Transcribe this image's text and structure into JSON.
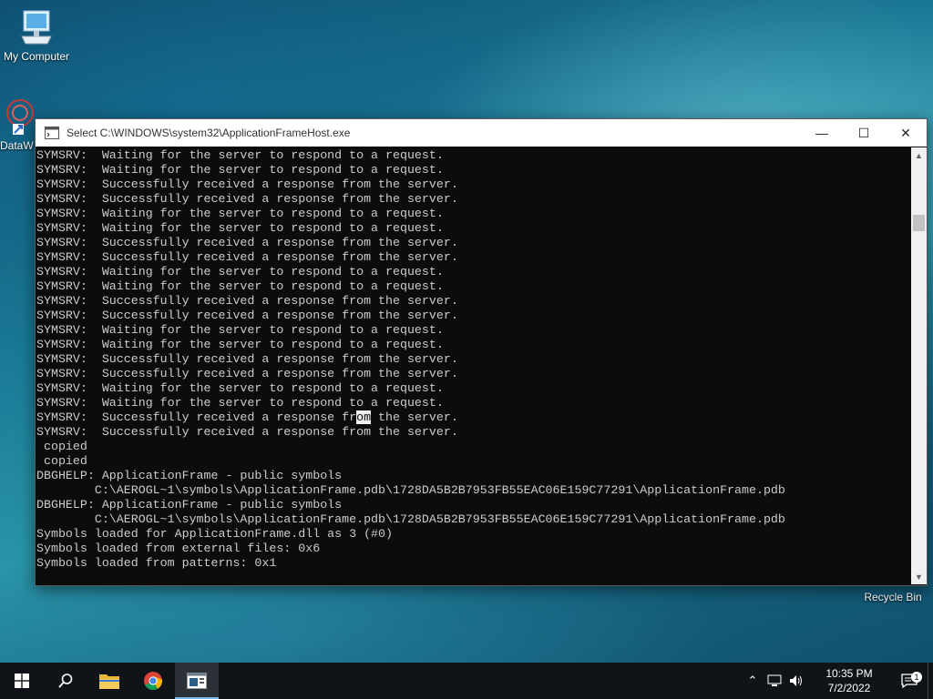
{
  "desktop": {
    "icons": [
      {
        "label": "My Computer",
        "icon": "computer-icon"
      },
      {
        "label": "DataW",
        "icon": "dataw-icon"
      },
      {
        "label": "Recycle Bin",
        "icon": "recycle-bin-icon"
      }
    ]
  },
  "window": {
    "title": "Select C:\\WINDOWS\\system32\\ApplicationFrameHost.exe",
    "controls": {
      "minimize": "—",
      "maximize": "☐",
      "close": "✕"
    }
  },
  "console": {
    "lines": [
      "SYMSRV:  Waiting for the server to respond to a request.",
      "SYMSRV:  Waiting for the server to respond to a request.",
      "SYMSRV:  Successfully received a response from the server.",
      "SYMSRV:  Successfully received a response from the server.",
      "SYMSRV:  Waiting for the server to respond to a request.",
      "SYMSRV:  Waiting for the server to respond to a request.",
      "SYMSRV:  Successfully received a response from the server.",
      "SYMSRV:  Successfully received a response from the server.",
      "SYMSRV:  Waiting for the server to respond to a request.",
      "SYMSRV:  Waiting for the server to respond to a request.",
      "SYMSRV:  Successfully received a response from the server.",
      "SYMSRV:  Successfully received a response from the server.",
      "SYMSRV:  Waiting for the server to respond to a request.",
      "SYMSRV:  Waiting for the server to respond to a request.",
      "SYMSRV:  Successfully received a response from the server.",
      "SYMSRV:  Successfully received a response from the server.",
      "SYMSRV:  Waiting for the server to respond to a request.",
      "SYMSRV:  Waiting for the server to respond to a request.",
      "SYMSRV:  Successfully received a response from the server.",
      "SYMSRV:  Successfully received a response from the server.",
      " copied",
      " copied",
      "DBGHELP: ApplicationFrame - public symbols",
      "        C:\\AEROGL~1\\symbols\\ApplicationFrame.pdb\\1728DA5B2B7953FB55EAC06E159C77291\\ApplicationFrame.pdb",
      "DBGHELP: ApplicationFrame - public symbols",
      "        C:\\AEROGL~1\\symbols\\ApplicationFrame.pdb\\1728DA5B2B7953FB55EAC06E159C77291\\ApplicationFrame.pdb",
      "Symbols loaded for ApplicationFrame.dll as 3 (#0)",
      "Symbols loaded from external files: 0x6",
      "Symbols loaded from patterns: 0x1"
    ],
    "selection": {
      "line": 18,
      "text": "om"
    }
  },
  "taskbar": {
    "apps": [
      {
        "name": "start-button",
        "icon": "windows-logo-icon"
      },
      {
        "name": "search-button",
        "icon": "search-icon"
      },
      {
        "name": "file-explorer-button",
        "icon": "folder-icon"
      },
      {
        "name": "chrome-button",
        "icon": "chrome-icon"
      },
      {
        "name": "console-button",
        "icon": "console-window-icon",
        "active": true
      }
    ],
    "tray": {
      "time": "10:35 PM",
      "date": "7/2/2022",
      "notification_count": "1"
    }
  },
  "colors": {
    "console_bg": "#0c0c0c",
    "console_fg": "#cccccc",
    "taskbar_bg": "#101418",
    "accent": "#76b9ed"
  }
}
